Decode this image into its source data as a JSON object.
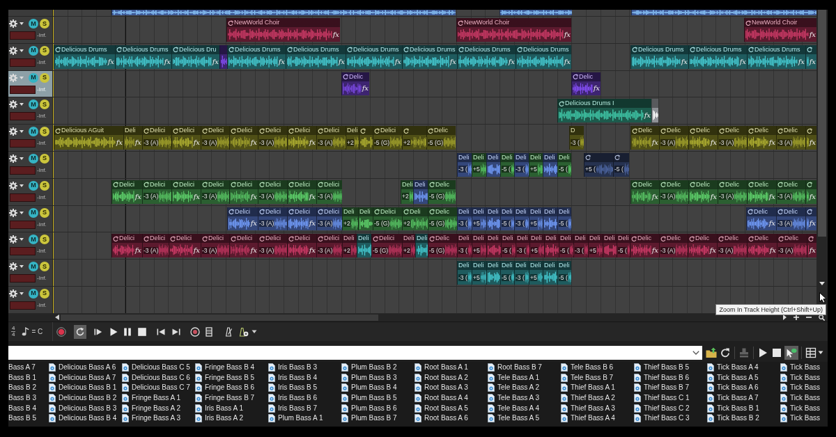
{
  "arrangement": {
    "track_above": {
      "clips": [
        {
          "color": "#3f5a96"
        },
        {
          "color": "#3f5a96"
        },
        {
          "color": "#3f5a96"
        }
      ]
    },
    "tracks": [
      {
        "selected": false,
        "mute": "M",
        "solo": "S",
        "volume": "-Inf.",
        "clips": [
          {
            "label": "NewWorld Choir",
            "fx": "fx",
            "color": "#5c1a2e"
          },
          {
            "label": "NewWorld Choir",
            "fx": "fx",
            "color": "#5c1a2e"
          },
          {
            "label": "NewWorld Choir",
            "fx": "fx",
            "color": "#5c1a2e"
          }
        ]
      },
      {
        "selected": false,
        "mute": "M",
        "solo": "S",
        "volume": "-Inf.",
        "clips": [
          {
            "label": "Delicious Drums",
            "fx": "fx",
            "color": "#1f5b5e"
          },
          {
            "label": "Delicious Drums",
            "fx": "fx",
            "color": "#1f5b5e"
          },
          {
            "label": "Delicious Dru",
            "fx": "fx",
            "color": "#1f5b5e"
          },
          {
            "color": "#3d2470"
          },
          {
            "label": "Delicious Drums",
            "fx": "fx",
            "color": "#1f5b5e"
          },
          {
            "label": "Delicious Drums",
            "fx": "fx",
            "color": "#1f5b5e"
          },
          {
            "label": "Delicious Drums",
            "fx": "fx",
            "color": "#1f5b5e"
          },
          {
            "label": "Delicious Drums",
            "fx": "fx",
            "color": "#1f5b5e"
          },
          {
            "label": "Delicious Drums",
            "fx": "fx",
            "color": "#1f5b5e"
          },
          {
            "label": "Delicious Drums",
            "fx": "fx",
            "color": "#1f5b5e"
          },
          {
            "label": "Delicious Drums",
            "fx": "fx",
            "color": "#1f5b5e"
          },
          {
            "label": "Delicious Drums",
            "fx": "fx",
            "color": "#1f5b5e"
          },
          {
            "label": "Delicious Drums",
            "fx": "fx",
            "color": "#1f5b5e"
          },
          {
            "fx": "fx",
            "color": "#1f5b5e"
          }
        ]
      },
      {
        "selected": true,
        "mute": "M",
        "solo": "S",
        "volume": "-Inf.",
        "clips": [
          {
            "label": "Delic",
            "fx": "fx",
            "color": "#3d2470"
          },
          {
            "label": "Delic",
            "fx": "fx",
            "color": "#3d2470"
          }
        ]
      },
      {
        "selected": false,
        "mute": "M",
        "solo": "S",
        "volume": "-Inf.",
        "clips": [
          {
            "label": "Delicious Drums I",
            "fx": "fx",
            "color": "#1d5a4c"
          },
          {
            "color": "#8e9196"
          }
        ]
      },
      {
        "selected": false,
        "mute": "M",
        "solo": "S",
        "volume": "-Inf.",
        "clips": [
          {
            "label": "Delicious AGuit",
            "fx": "fx",
            "color": "#4f4f16"
          },
          {
            "label": "Deli",
            "fx": "fx",
            "color": "#4f4f16"
          },
          {
            "label": "Delici",
            "pitch": "-3 (A)",
            "color": "#4f4f16"
          },
          {
            "label": "Delici",
            "fx": "fx",
            "color": "#4f4f16"
          },
          {
            "label": "Delici",
            "pitch": "-3 (A)",
            "color": "#4f4f16"
          },
          {
            "label": "Delici",
            "fx": "fx",
            "color": "#4f4f16"
          },
          {
            "label": "Delici",
            "pitch": "-3 (A)",
            "color": "#4f4f16"
          },
          {
            "label": "Delici",
            "fx": "fx",
            "color": "#4f4f16"
          },
          {
            "label": "Delici",
            "pitch": "-3 (A)",
            "color": "#4f4f16"
          },
          {
            "label": "Deli",
            "pitch": "+2",
            "color": "#4f4f16"
          },
          {
            "color": "#4f4f16"
          },
          {
            "label": "Delici",
            "pitch": "-5 (G)",
            "color": "#4f4f16"
          },
          {
            "pitch": "+2",
            "color": "#4f4f16"
          },
          {
            "label": "Delic",
            "pitch": "-5 (G)",
            "color": "#4f4f16"
          },
          {
            "label": "D",
            "pitch": "-3 (",
            "color": "#4f4f16"
          },
          {
            "label": "Delic",
            "fx": "fx",
            "color": "#4f4f16"
          },
          {
            "label": "Delic",
            "pitch": "-3 (A)",
            "color": "#4f4f16"
          },
          {
            "label": "Delic",
            "fx": "fx",
            "color": "#4f4f16"
          },
          {
            "label": "Delic",
            "pitch": "-3 (A)",
            "color": "#4f4f16"
          },
          {
            "label": "Delic",
            "fx": "fx",
            "color": "#4f4f16"
          },
          {
            "label": "Delic",
            "pitch": "-3 (A)",
            "color": "#4f4f16"
          },
          {
            "fx": "fx",
            "color": "#4f4f16"
          }
        ]
      },
      {
        "selected": false,
        "mute": "M",
        "solo": "S",
        "volume": "-Inf.",
        "clips": [
          {
            "label": "Deli",
            "pitch": "-3 (",
            "color": "#34477a"
          },
          {
            "label": "Deli",
            "pitch": "+5",
            "color": "#2b5f31"
          },
          {
            "label": "Deli",
            "color": "#34477a"
          },
          {
            "label": "Deli",
            "pitch": "-5 (",
            "color": "#2b5f31"
          },
          {
            "label": "Deli",
            "pitch": "-3 (",
            "color": "#34477a"
          },
          {
            "label": "Deli",
            "pitch": "+5",
            "color": "#2b5f31"
          },
          {
            "label": "Deli",
            "color": "#34477a"
          },
          {
            "label": "Deli",
            "pitch": "-5 (",
            "color": "#2b5f31"
          },
          {
            "pitch": "+5 (",
            "color": "#26324f"
          },
          {
            "pitch": "-5 (",
            "color": "#26324f"
          }
        ]
      },
      {
        "selected": false,
        "mute": "M",
        "solo": "S",
        "volume": "-Inf.",
        "clips": [
          {
            "label": "Delici",
            "fx": "fx",
            "color": "#2b5f31"
          },
          {
            "label": "Delici",
            "pitch": "-3 (A)",
            "color": "#2b5f31"
          },
          {
            "label": "Delici",
            "fx": "fx",
            "color": "#2b5f31"
          },
          {
            "label": "Delici",
            "pitch": "-3 (A)",
            "color": "#2b5f31"
          },
          {
            "label": "Delici",
            "fx": "fx",
            "color": "#2b5f31"
          },
          {
            "label": "Delici",
            "pitch": "-3 (A)",
            "color": "#2b5f31"
          },
          {
            "label": "Delici",
            "fx": "fx",
            "color": "#2b5f31"
          },
          {
            "label": "Delici",
            "pitch": "-3 (A)",
            "color": "#2b5f31"
          },
          {
            "label": "Deli",
            "pitch": "+2",
            "color": "#2b5f31"
          },
          {
            "label": "Deli",
            "color": "#34477a"
          },
          {
            "label": "Delic",
            "pitch": "-5 (G)",
            "color": "#2b5f31"
          },
          {
            "label": "Delic",
            "fx": "fx",
            "color": "#2b5f31"
          },
          {
            "label": "Delic",
            "pitch": "-3 (A)",
            "color": "#2b5f31"
          },
          {
            "label": "Delic",
            "fx": "fx",
            "color": "#2b5f31"
          },
          {
            "label": "Delic",
            "pitch": "-3 (A)",
            "color": "#2b5f31"
          },
          {
            "label": "Delic",
            "fx": "fx",
            "color": "#2b5f31"
          },
          {
            "label": "Delic",
            "pitch": "-3 (A)",
            "color": "#2b5f31"
          },
          {
            "fx": "fx",
            "color": "#2b5f31"
          }
        ]
      },
      {
        "selected": false,
        "mute": "M",
        "solo": "S",
        "volume": "-Inf.",
        "clips": [
          {
            "label": "Delici",
            "fx": "fx",
            "color": "#34477a"
          },
          {
            "label": "Delici",
            "pitch": "-3 (A)",
            "color": "#34477a"
          },
          {
            "label": "Delici",
            "fx": "fx",
            "color": "#34477a"
          },
          {
            "label": "Delici",
            "pitch": "-3 (A)",
            "color": "#34477a"
          },
          {
            "label": "Deli",
            "pitch": "+2",
            "color": "#2b5f31"
          },
          {
            "label": "Deli",
            "color": "#2b5f31"
          },
          {
            "label": "Delici",
            "pitch": "-5 (G)",
            "color": "#2b5f31"
          },
          {
            "label": "Deli",
            "pitch": "+2",
            "color": "#2b5f31"
          },
          {
            "label": "Delic",
            "pitch": "-5 (G)",
            "color": "#2b5f31"
          },
          {
            "label": "Deli",
            "pitch": "-3 (",
            "color": "#34477a"
          },
          {
            "label": "Deli",
            "pitch": "+5",
            "color": "#34477a"
          },
          {
            "label": "Deli",
            "color": "#34477a"
          },
          {
            "label": "Deli",
            "pitch": "-5 (",
            "color": "#34477a"
          },
          {
            "label": "Deli",
            "pitch": "-3 (",
            "color": "#34477a"
          },
          {
            "label": "Deli",
            "pitch": "+5",
            "color": "#34477a"
          },
          {
            "label": "Deli",
            "color": "#34477a"
          },
          {
            "label": "Deli",
            "pitch": "-5 (",
            "color": "#34477a"
          },
          {
            "label": "Delic",
            "fx": "fx",
            "color": "#34477a"
          },
          {
            "label": "Delic",
            "pitch": "-3 (A)",
            "color": "#34477a"
          },
          {
            "fx": "fx",
            "color": "#34477a"
          }
        ]
      },
      {
        "selected": false,
        "mute": "M",
        "solo": "S",
        "volume": "-Inf.",
        "clips": [
          {
            "label": "Delici",
            "fx": "fx",
            "color": "#5c1a2e"
          },
          {
            "label": "Delici",
            "pitch": "-3 (A)",
            "color": "#5c1a2e"
          },
          {
            "label": "Delici",
            "fx": "fx",
            "color": "#5c1a2e"
          },
          {
            "label": "Delici",
            "pitch": "-3 (A)",
            "color": "#5c1a2e"
          },
          {
            "label": "Delici",
            "fx": "fx",
            "color": "#5c1a2e"
          },
          {
            "label": "Delici",
            "pitch": "-3 (A)",
            "color": "#5c1a2e"
          },
          {
            "label": "Delici",
            "fx": "fx",
            "color": "#5c1a2e"
          },
          {
            "label": "Delici",
            "pitch": "-3 (A)",
            "color": "#5c1a2e"
          },
          {
            "label": "Deli",
            "pitch": "+2",
            "color": "#5c1a2e"
          },
          {
            "label": "Deli",
            "color": "#1f5b5e"
          },
          {
            "label": "Delici",
            "pitch": "-5 (G)",
            "color": "#5c1a2e"
          },
          {
            "label": "Deli",
            "pitch": "+2",
            "color": "#5c1a2e"
          },
          {
            "label": "Deli",
            "color": "#1f5b5e"
          },
          {
            "label": "Delic",
            "pitch": "-5 (G)",
            "color": "#5c1a2e"
          },
          {
            "label": "Deli",
            "pitch": "-3 (",
            "color": "#5c1a2e"
          },
          {
            "label": "Deli",
            "pitch": "+5",
            "color": "#5c1a2e"
          },
          {
            "label": "Deli",
            "color": "#5c1a2e"
          },
          {
            "label": "Deli",
            "pitch": "-5 (",
            "color": "#5c1a2e"
          },
          {
            "label": "Deli",
            "pitch": "-3 (",
            "color": "#5c1a2e"
          },
          {
            "label": "Deli",
            "pitch": "+5",
            "color": "#5c1a2e"
          },
          {
            "label": "Deli",
            "color": "#5c1a2e"
          },
          {
            "label": "Deli",
            "pitch": "-5 (",
            "color": "#5c1a2e"
          },
          {
            "label": "Deli",
            "pitch": "-3 (",
            "color": "#5c1a2e"
          },
          {
            "label": "Deli",
            "pitch": "+5",
            "color": "#5c1a2e"
          },
          {
            "label": "Deli",
            "color": "#5c1a2e"
          },
          {
            "label": "Deli",
            "pitch": "-5 (",
            "color": "#5c1a2e"
          },
          {
            "label": "Delic",
            "fx": "fx",
            "color": "#5c1a2e"
          },
          {
            "label": "Delic",
            "pitch": "-3 (A)",
            "color": "#5c1a2e"
          },
          {
            "label": "Delic",
            "fx": "fx",
            "color": "#5c1a2e"
          },
          {
            "label": "Delic",
            "pitch": "-3 (A)",
            "color": "#5c1a2e"
          },
          {
            "label": "Delic",
            "fx": "fx",
            "color": "#5c1a2e"
          },
          {
            "label": "Delic",
            "pitch": "-3 (A)",
            "color": "#5c1a2e"
          },
          {
            "fx": "fx",
            "color": "#5c1a2e"
          }
        ]
      },
      {
        "selected": false,
        "mute": "M",
        "solo": "S",
        "volume": "-Inf.",
        "clips": [
          {
            "label": "Deli",
            "pitch": "-3 (",
            "color": "#1f5b5e"
          },
          {
            "label": "Deli",
            "pitch": "+5",
            "color": "#1f5b5e"
          },
          {
            "label": "Deli",
            "color": "#1f5b5e"
          },
          {
            "label": "Deli",
            "pitch": "-5 (",
            "color": "#1f5b5e"
          },
          {
            "label": "Deli",
            "pitch": "-3 (",
            "color": "#1f5b5e"
          },
          {
            "label": "Deli",
            "pitch": "+5",
            "color": "#1f5b5e"
          },
          {
            "label": "Deli",
            "color": "#1f5b5e"
          },
          {
            "label": "Deli",
            "pitch": "-5 (",
            "color": "#1f5b5e"
          }
        ]
      },
      {
        "selected": false,
        "mute": "M",
        "solo": "S",
        "volume": "-Inf."
      }
    ],
    "tooltip": "Zoom In Track Height (Ctrl+Shift+Up)"
  },
  "transport": {
    "time_signature": {
      "beats": "4",
      "unit": "4"
    },
    "key": "= C",
    "buttons": [
      {
        "kind": "record",
        "selected": false
      },
      {
        "kind": "loop",
        "selected": true
      },
      {
        "kind": "play-from-start",
        "selected": false
      },
      {
        "kind": "play",
        "selected": false
      },
      {
        "kind": "pause",
        "selected": false
      },
      {
        "kind": "stop",
        "selected": false
      },
      {
        "kind": "go-to-start",
        "selected": false
      },
      {
        "kind": "go-to-end",
        "selected": false
      },
      {
        "kind": "target",
        "selected": false
      },
      {
        "kind": "film-strip",
        "selected": false
      },
      {
        "kind": "metronome",
        "selected": false
      },
      {
        "kind": "metronome-badge",
        "selected": false
      },
      {
        "kind": "menu",
        "selected": false
      }
    ]
  },
  "explorer": {
    "toolbar": [
      {
        "kind": "folder-up",
        "selected": false,
        "disabled": false
      },
      {
        "kind": "refresh",
        "selected": false,
        "disabled": false
      },
      {
        "kind": "stamp",
        "selected": false,
        "disabled": true
      },
      {
        "kind": "play",
        "selected": false,
        "disabled": false
      },
      {
        "kind": "stop",
        "selected": false,
        "disabled": false
      },
      {
        "kind": "auto-preview",
        "selected": true,
        "disabled": false
      },
      {
        "kind": "views",
        "selected": false,
        "disabled": false
      },
      {
        "kind": "menu",
        "selected": false,
        "disabled": false
      }
    ],
    "file_columns": [
      {
        "icons": false,
        "files": [
          "Bass A 7",
          "Bass B 1",
          "Bass B 2",
          "Bass B 3",
          "Bass B 4",
          "Bass B 5"
        ]
      },
      {
        "icons": true,
        "files": [
          "Delicious Bass A 6",
          "Delicious Bass A 7",
          "Delicious Bass B 1",
          "Delicious Bass B 2",
          "Delicious Bass B 3",
          "Delicious Bass B 4"
        ]
      },
      {
        "icons": true,
        "files": [
          "Delicious Bass C 5",
          "Delicious Bass C 6",
          "Delicious Bass C 7",
          "Fringe Bass A 1",
          "Fringe Bass A 2",
          "Fringe Bass A 3"
        ]
      },
      {
        "icons": true,
        "files": [
          "Fringe Bass B 4",
          "Fringe Bass B 5",
          "Fringe Bass B 6",
          "Fringe Bass B 7",
          "Iris Bass A 1",
          "Iris Bass A 2"
        ]
      },
      {
        "icons": true,
        "files": [
          "Iris Bass B 3",
          "Iris Bass B 4",
          "Iris Bass B 5",
          "Iris Bass B 6",
          "Iris Bass B 7",
          "Plum Bass A 1"
        ]
      },
      {
        "icons": true,
        "files": [
          "Plum Bass B 2",
          "Plum Bass B 3",
          "Plum Bass B 4",
          "Plum Bass B 5",
          "Plum Bass B 6",
          "Plum Bass B 7"
        ]
      },
      {
        "icons": true,
        "files": [
          "Root Bass A 1",
          "Root Bass A 2",
          "Root Bass A 3",
          "Root Bass A 4",
          "Root Bass A 5",
          "Root Bass A 6"
        ]
      },
      {
        "icons": true,
        "files": [
          "Root Bass B 7",
          "Tele Bass A 1",
          "Tele Bass A 2",
          "Tele Bass A 3",
          "Tele Bass A 4",
          "Tele Bass A 5"
        ]
      },
      {
        "icons": true,
        "files": [
          "Tele Bass B 6",
          "Tele Bass B 7",
          "Thief Bass A 1",
          "Thief Bass A 2",
          "Thief Bass A 3",
          "Thief Bass A 4"
        ]
      },
      {
        "icons": true,
        "files": [
          "Thief Bass B 5",
          "Thief Bass B 6",
          "Thief Bass B 7",
          "Thief Bass C 1",
          "Thief Bass C 2",
          "Thief Bass C 3"
        ]
      },
      {
        "icons": true,
        "files": [
          "Tick Bass A 4",
          "Tick Bass A 5",
          "Tick Bass A 6",
          "Tick Bass A 7",
          "Tick Bass B 1",
          "Tick Bass B 2"
        ]
      },
      {
        "icons": true,
        "files": [
          "Tick Bass",
          "Tick Bass",
          "Tick Bass",
          "Tick Bass",
          "Tick Bass",
          "Tick Bass"
        ]
      }
    ]
  }
}
